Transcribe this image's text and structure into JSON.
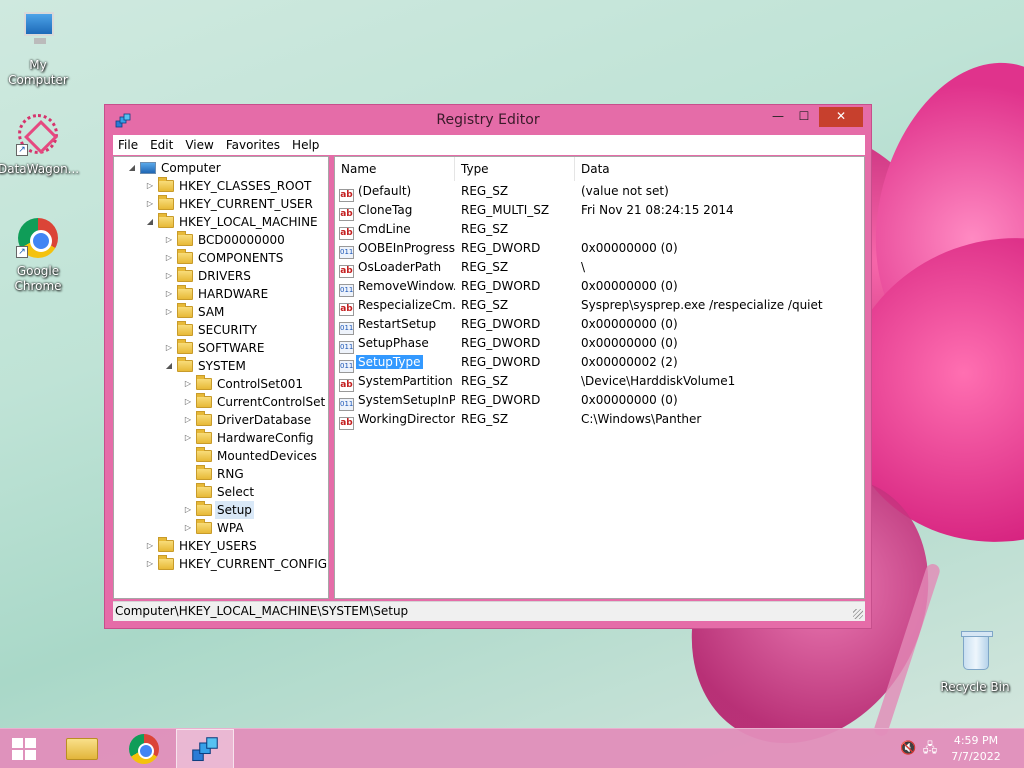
{
  "desktop": {
    "icons": [
      {
        "label": "My Computer",
        "icon": "computer-icon"
      },
      {
        "label": "DataWagon...",
        "icon": "datawagon-icon"
      },
      {
        "label": "Google Chrome",
        "icon": "chrome-icon"
      },
      {
        "label": "Recycle Bin",
        "icon": "recycle-bin-icon"
      }
    ]
  },
  "window": {
    "title": "Registry Editor",
    "controls": {
      "minimize": "—",
      "maximize": "☐",
      "close": "✕"
    },
    "menu": [
      "File",
      "Edit",
      "View",
      "Favorites",
      "Help"
    ],
    "tree": [
      {
        "label": "Computer",
        "expander": "◢",
        "kind": "pc"
      },
      {
        "label": "HKEY_CLASSES_ROOT",
        "expander": "▷"
      },
      {
        "label": "HKEY_CURRENT_USER",
        "expander": "▷"
      },
      {
        "label": "HKEY_LOCAL_MACHINE",
        "expander": "◢"
      },
      {
        "label": "BCD00000000",
        "expander": "▷"
      },
      {
        "label": "COMPONENTS",
        "expander": "▷"
      },
      {
        "label": "DRIVERS",
        "expander": "▷"
      },
      {
        "label": "HARDWARE",
        "expander": "▷"
      },
      {
        "label": "SAM",
        "expander": "▷"
      },
      {
        "label": "SECURITY",
        "expander": ""
      },
      {
        "label": "SOFTWARE",
        "expander": "▷"
      },
      {
        "label": "SYSTEM",
        "expander": "◢"
      },
      {
        "label": "ControlSet001",
        "expander": "▷"
      },
      {
        "label": "CurrentControlSet",
        "expander": "▷"
      },
      {
        "label": "DriverDatabase",
        "expander": "▷"
      },
      {
        "label": "HardwareConfig",
        "expander": "▷"
      },
      {
        "label": "MountedDevices",
        "expander": ""
      },
      {
        "label": "RNG",
        "expander": ""
      },
      {
        "label": "Select",
        "expander": ""
      },
      {
        "label": "Setup",
        "expander": "▷",
        "selected": true
      },
      {
        "label": "WPA",
        "expander": "▷"
      },
      {
        "label": "HKEY_USERS",
        "expander": "▷"
      },
      {
        "label": "HKEY_CURRENT_CONFIG",
        "expander": "▷"
      }
    ],
    "columns": {
      "name": "Name",
      "type": "Type",
      "data": "Data"
    },
    "values": [
      {
        "name": "(Default)",
        "type": "REG_SZ",
        "data": "(value not set)",
        "icon": "ab"
      },
      {
        "name": "CloneTag",
        "type": "REG_MULTI_SZ",
        "data": "Fri Nov 21 08:24:15 2014",
        "icon": "ab"
      },
      {
        "name": "CmdLine",
        "type": "REG_SZ",
        "data": "",
        "icon": "ab"
      },
      {
        "name": "OOBEInProgress",
        "type": "REG_DWORD",
        "data": "0x00000000 (0)",
        "icon": "011"
      },
      {
        "name": "OsLoaderPath",
        "type": "REG_SZ",
        "data": "\\",
        "icon": "ab"
      },
      {
        "name": "RemoveWindow...",
        "type": "REG_DWORD",
        "data": "0x00000000 (0)",
        "icon": "011"
      },
      {
        "name": "RespecializeCm...",
        "type": "REG_SZ",
        "data": "Sysprep\\sysprep.exe /respecialize /quiet",
        "icon": "ab"
      },
      {
        "name": "RestartSetup",
        "type": "REG_DWORD",
        "data": "0x00000000 (0)",
        "icon": "011"
      },
      {
        "name": "SetupPhase",
        "type": "REG_DWORD",
        "data": "0x00000000 (0)",
        "icon": "011"
      },
      {
        "name": "SetupType",
        "type": "REG_DWORD",
        "data": "0x00000002 (2)",
        "icon": "011",
        "selected": true
      },
      {
        "name": "SystemPartition",
        "type": "REG_SZ",
        "data": "\\Device\\HarddiskVolume1",
        "icon": "ab"
      },
      {
        "name": "SystemSetupInP...",
        "type": "REG_DWORD",
        "data": "0x00000000 (0)",
        "icon": "011"
      },
      {
        "name": "WorkingDirectory",
        "type": "REG_SZ",
        "data": "C:\\Windows\\Panther",
        "icon": "ab"
      }
    ],
    "status": "Computer\\HKEY_LOCAL_MACHINE\\SYSTEM\\Setup"
  },
  "taskbar": {
    "buttons": [
      "start-button",
      "file-explorer-button",
      "chrome-button",
      "registry-editor-button"
    ],
    "tray": {
      "volume_icon": "🔇",
      "network_icon": "🖧"
    },
    "clock": {
      "time": "4:59 PM",
      "date": "7/7/2022"
    }
  },
  "colors": {
    "window_frame": "#e56ca8",
    "close_button": "#c7402d",
    "selection": "#3399ff"
  }
}
